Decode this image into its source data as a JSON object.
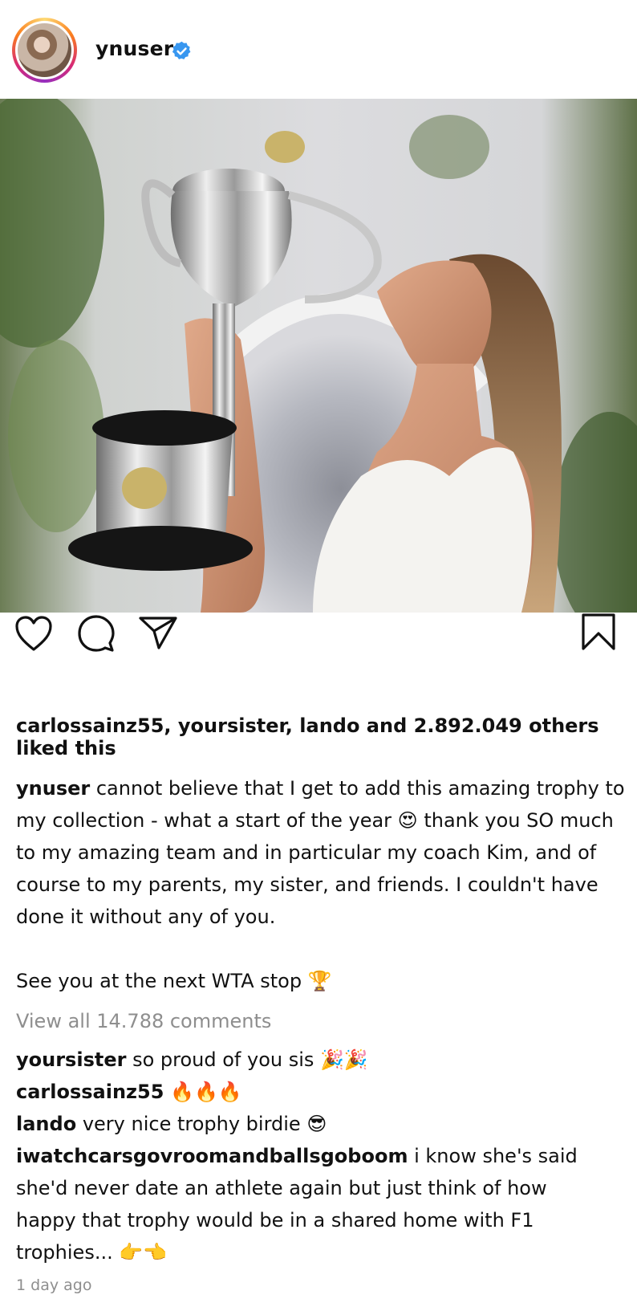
{
  "post": {
    "username": "ynuser",
    "verified": true,
    "likes_text": "carlossainz55, yoursister, lando and 2.892.049 others liked this",
    "caption_username": "ynuser",
    "caption_text": "cannot believe that I get to add this amazing trophy to my collection - what a start of the year 😍 thank you SO much to my amazing team and in particular my coach Kim, and of course to my parents, my sister, and friends. I couldn't have done it without any of you.",
    "caption_text_2": "See you at the next WTA stop 🏆",
    "view_all_comments": "View all 14.788 comments",
    "comments": [
      {
        "username": "yoursister",
        "text": "so proud of you sis 🎉🎉"
      },
      {
        "username": "carlossainz55",
        "text": "🔥🔥🔥"
      },
      {
        "username": "lando",
        "text": "very nice trophy birdie 😎"
      },
      {
        "username": "iwatchcarsgovroomandballsgoboom",
        "text": "i know she's said she'd never date an athlete again but just think of how happy that trophy would be in a shared home with F1 trophies... 👉👈"
      }
    ],
    "timestamp": "1 day ago"
  },
  "icons": {
    "like": "heart-icon",
    "comment": "comment-icon",
    "share": "paper-plane-icon",
    "save": "bookmark-icon",
    "verified": "verified-badge-icon"
  },
  "colors": {
    "verified": "#3897f0",
    "muted": "#8e8e8e",
    "text": "#111111"
  }
}
